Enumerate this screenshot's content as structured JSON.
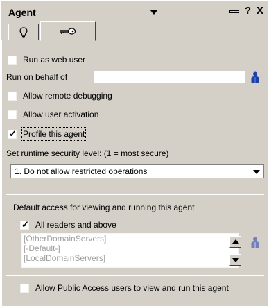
{
  "window": {
    "title": "Agent",
    "help_label": "?",
    "close_label": "X"
  },
  "tabs": [
    {
      "name": "basics",
      "icon": "lightbulb-icon"
    },
    {
      "name": "security",
      "icon": "key-icon",
      "selected": true
    }
  ],
  "options": {
    "run_as_web_user": {
      "label": "Run as web user",
      "checked": false
    },
    "run_on_behalf": {
      "label": "Run on behalf of",
      "value": ""
    },
    "allow_remote_debugging": {
      "label": "Allow remote debugging",
      "checked": false
    },
    "allow_user_activation": {
      "label": "Allow user activation",
      "checked": false
    },
    "profile_agent": {
      "label": "Profile this agent",
      "checked": true
    }
  },
  "security_level": {
    "label": "Set runtime security level: (1 = most secure)",
    "selected": "1. Do not allow restricted operations"
  },
  "default_access": {
    "label": "Default access for viewing and running this agent",
    "all_readers": {
      "label": "All readers and above",
      "checked": true
    },
    "list_items": [
      "[OtherDomainServers]",
      "[-Default-]",
      "[LocalDomainServers]"
    ]
  },
  "public_access": {
    "label": "Allow Public Access users to view and run this agent",
    "checked": false
  },
  "colors": {
    "panel": "#d4d0c8",
    "person_icon": "#1f3fa8",
    "disabled_text": "#a0a0a0"
  }
}
